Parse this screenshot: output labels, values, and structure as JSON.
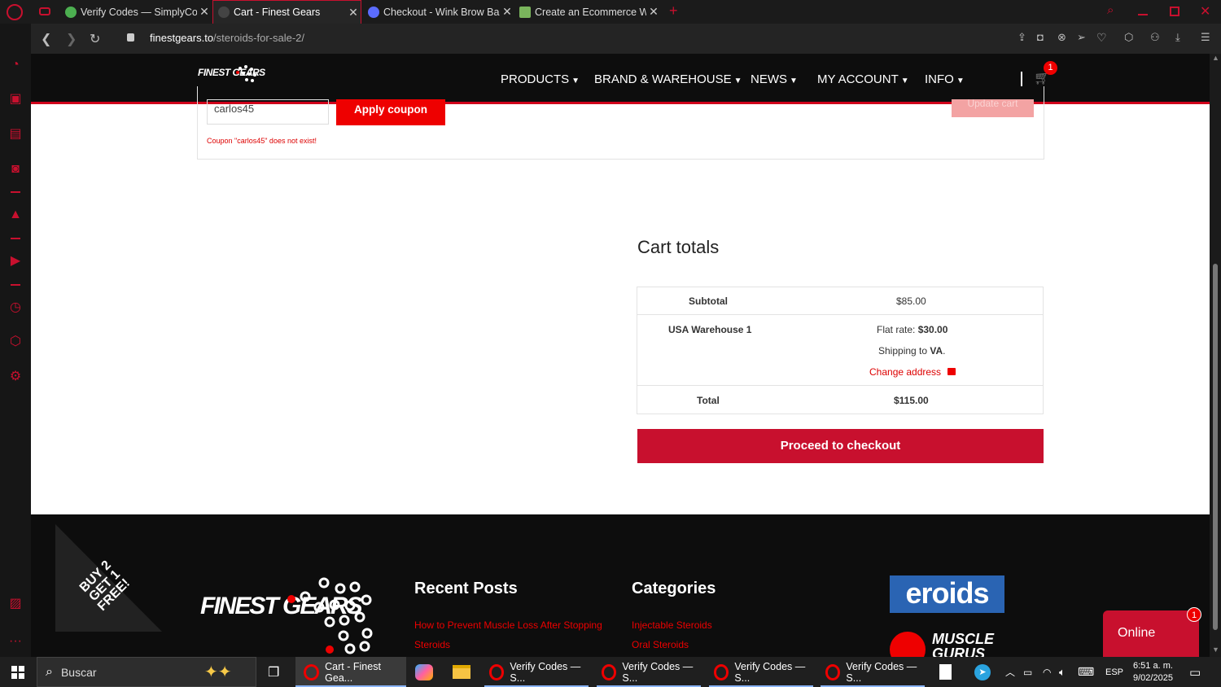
{
  "browser": {
    "tabs": [
      {
        "title": "Verify Codes — SimplyCodes",
        "active": false
      },
      {
        "title": "Cart - Finest Gears",
        "active": true
      },
      {
        "title": "Checkout - Wink Brow Bar",
        "active": false
      },
      {
        "title": "Create an Ecommerce Website",
        "active": false
      }
    ],
    "url_host": "finestgears.to",
    "url_path": "/steroids-for-sale-2/"
  },
  "site": {
    "logo_text": "FINEST GEARS",
    "nav": [
      "PRODUCTS",
      "BRAND & WAREHOUSE",
      "NEWS",
      "MY ACCOUNT",
      "INFO"
    ],
    "cart_count": "1"
  },
  "coupon": {
    "value": "carlos45",
    "apply_label": "Apply coupon",
    "update_label": "Update cart",
    "error": "Coupon \"carlos45\" does not exist!"
  },
  "totals": {
    "heading": "Cart totals",
    "subtotal_label": "Subtotal",
    "subtotal_value": "$85.00",
    "shipping_label": "USA Warehouse 1",
    "flat_rate_label": "Flat rate:",
    "flat_rate_value": "$30.00",
    "shipping_to": "Shipping to",
    "shipping_state": "VA",
    "change_address": "Change address",
    "total_label": "Total",
    "total_value": "$115.00",
    "checkout_label": "Proceed to checkout"
  },
  "footer": {
    "promo": "BUY 2 GET 1 FREE!",
    "promo_lines": [
      "BUY 2",
      "GET 1",
      "FREE!"
    ],
    "recent_heading": "Recent Posts",
    "recent_posts": [
      "How to Prevent Muscle Loss After Stopping",
      "Steroids"
    ],
    "categories_heading": "Categories",
    "categories": [
      "Injectable Steroids",
      "Oral Steroids"
    ],
    "eroids_logo": "eroids",
    "muscle_logo": "MUSCLE GURUS"
  },
  "chat": {
    "label": "Online",
    "badge": "1"
  },
  "taskbar": {
    "search_placeholder": "Buscar",
    "apps": [
      {
        "label": "Cart - Finest Gea...",
        "active": true
      },
      {
        "label": "Verify Codes — S..."
      },
      {
        "label": "Verify Codes — S..."
      },
      {
        "label": "Verify Codes — S..."
      },
      {
        "label": "Verify Codes — S..."
      }
    ],
    "lang": "ESP",
    "time": "6:51 a. m.",
    "date": "9/02/2025"
  }
}
